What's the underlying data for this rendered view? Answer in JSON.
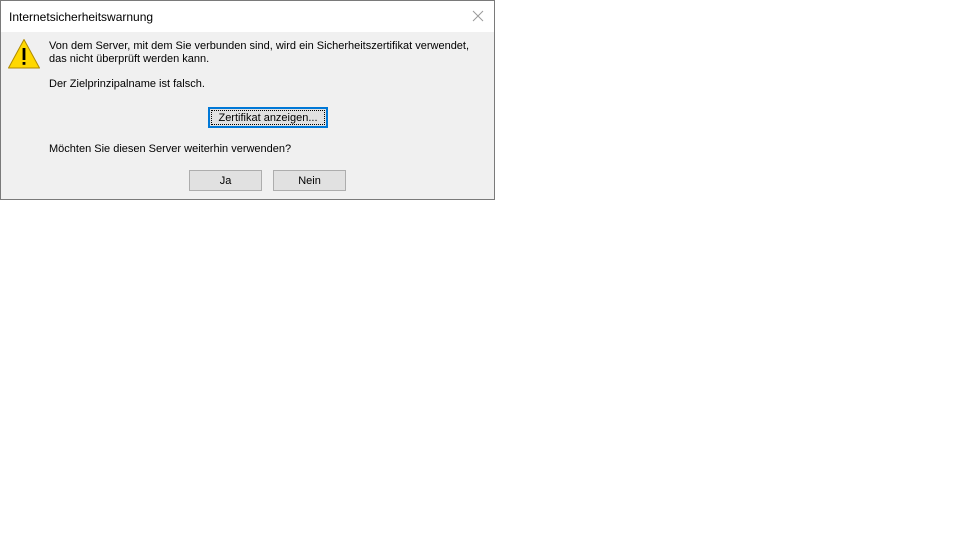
{
  "dialog": {
    "title": "Internetsicherheitswarnung",
    "icon": "warning-icon",
    "message_line1": "Von dem Server, mit dem Sie verbunden sind, wird ein Sicherheitszertifikat verwendet,",
    "message_line2": "das nicht überprüft werden kann.",
    "detail": "Der Zielprinzipalname ist falsch.",
    "question": "Möchten Sie diesen Server weiterhin verwenden?",
    "buttons": {
      "view_certificate": "Zertifikat anzeigen...",
      "yes": "Ja",
      "no": "Nein"
    }
  },
  "colors": {
    "dialog_bg": "#f0f0f0",
    "focus_accent": "#0078d7",
    "warning_yellow": "#ffd800"
  }
}
